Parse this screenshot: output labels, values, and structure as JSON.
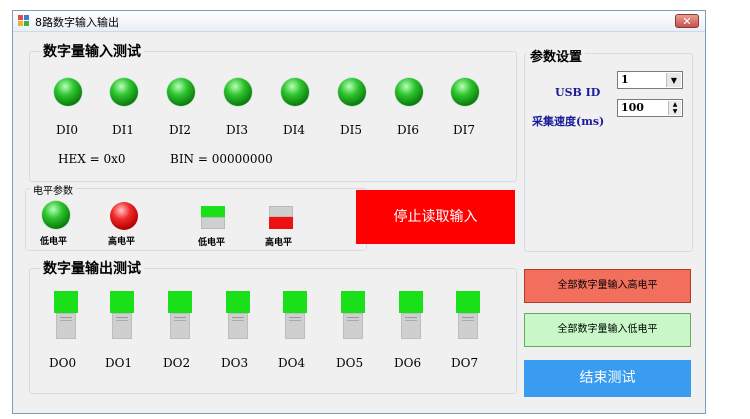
{
  "window": {
    "title": "8路数字输入输出",
    "close_glyph": "✕"
  },
  "input_group": {
    "title": "数字量输入测试",
    "leds": [
      "DI0",
      "DI1",
      "DI2",
      "DI3",
      "DI4",
      "DI5",
      "DI6",
      "DI7"
    ],
    "hex_text": "HEX = 0x0",
    "bin_text": "BIN = 00000000"
  },
  "level_group": {
    "title": "电平参数",
    "green_led_label": "低电平",
    "red_led_label": "高电平",
    "green_switch_label": "低电平",
    "red_switch_label": "高电平"
  },
  "stop_button": {
    "label": "停止读取输入",
    "color": "#ff0000"
  },
  "params_group": {
    "title": "参数设置",
    "usb_label": "USB ID",
    "usb_value": "1",
    "speed_label": "采集速度(ms)",
    "speed_value": "100"
  },
  "output_group": {
    "title": "数字量输出测试",
    "switches": [
      "DO0",
      "DO1",
      "DO2",
      "DO3",
      "DO4",
      "DO5",
      "DO6",
      "DO7"
    ]
  },
  "buttons": {
    "all_high": "全部数字量输入高电平",
    "all_low": "全部数字量输入低电平",
    "end_test": "结束测试"
  },
  "colors": {
    "high_button": "#f36f5d",
    "low_button": "#c8f7c8",
    "end_button": "#3a9cf0",
    "switch_on": "#19e019"
  }
}
